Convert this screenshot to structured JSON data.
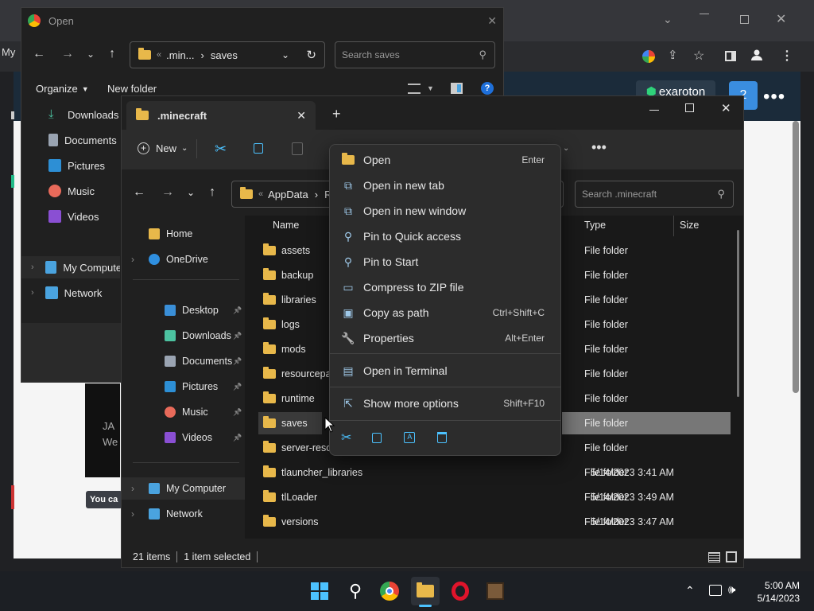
{
  "browser": {
    "left_label": "My",
    "profile_initial": "2",
    "exaroton": "exaroton",
    "web_text": "JA\nWe",
    "badge": "You ca"
  },
  "open_dialog": {
    "title": "Open",
    "path_prefix": "«",
    "path_parts": [
      ".min...",
      "saves"
    ],
    "search_placeholder": "Search saves",
    "organize": "Organize",
    "new_folder": "New folder",
    "sidebar": [
      {
        "label": "Downloads",
        "icon": "download-icon"
      },
      {
        "label": "Documents",
        "icon": "document-icon"
      },
      {
        "label": "Pictures",
        "icon": "picture-icon"
      },
      {
        "label": "Music",
        "icon": "music-icon"
      },
      {
        "label": "Videos",
        "icon": "video-icon"
      },
      {
        "label": "My Computer",
        "icon": "computer-icon"
      },
      {
        "label": "Network",
        "icon": "network-icon"
      }
    ]
  },
  "explorer": {
    "tab_title": ".minecraft",
    "new_label": "New",
    "path_prefix": "«",
    "path_parts": [
      "AppData",
      "Ro"
    ],
    "search_placeholder": "Search .minecraft",
    "columns": {
      "name": "Name",
      "type": "Type",
      "size": "Size"
    },
    "sidebar": [
      {
        "label": "Home",
        "icon": "home-icon"
      },
      {
        "label": "OneDrive",
        "icon": "onedrive-icon"
      },
      {
        "label": "Desktop",
        "icon": "desktop-icon"
      },
      {
        "label": "Downloads",
        "icon": "download-icon"
      },
      {
        "label": "Documents",
        "icon": "document-icon"
      },
      {
        "label": "Pictures",
        "icon": "picture-icon"
      },
      {
        "label": "Music",
        "icon": "music-icon"
      },
      {
        "label": "Videos",
        "icon": "video-icon"
      },
      {
        "label": "My Computer",
        "icon": "computer-icon"
      },
      {
        "label": "Network",
        "icon": "network-icon"
      }
    ],
    "files": [
      {
        "name": "assets",
        "date": "",
        "type": "File folder"
      },
      {
        "name": "backup",
        "date": "",
        "type": "File folder"
      },
      {
        "name": "libraries",
        "date": "",
        "type": "File folder"
      },
      {
        "name": "logs",
        "date": "",
        "type": "File folder"
      },
      {
        "name": "mods",
        "date": "",
        "type": "File folder"
      },
      {
        "name": "resourcepac",
        "date": "",
        "type": "File folder"
      },
      {
        "name": "runtime",
        "date": "",
        "type": "File folder"
      },
      {
        "name": "saves",
        "date": "",
        "type": "File folder"
      },
      {
        "name": "server-resou",
        "date": "",
        "type": "File folder"
      },
      {
        "name": "tlauncher_libraries",
        "date": "5/14/2023 3:41 AM",
        "type": "File folder"
      },
      {
        "name": "tlLoader",
        "date": "5/14/2023 3:49 AM",
        "type": "File folder"
      },
      {
        "name": "versions",
        "date": "5/14/2023 3:47 AM",
        "type": "File folder"
      }
    ],
    "selected_index": 7,
    "status": {
      "items": "21 items",
      "selected": "1 item selected"
    }
  },
  "context_menu": {
    "items": [
      {
        "label": "Open",
        "shortcut": "Enter",
        "icon": "folder-open-icon"
      },
      {
        "label": "Open in new tab",
        "shortcut": "",
        "icon": "new-tab-icon"
      },
      {
        "label": "Open in new window",
        "shortcut": "",
        "icon": "new-window-icon"
      },
      {
        "label": "Pin to Quick access",
        "shortcut": "",
        "icon": "pin-icon"
      },
      {
        "label": "Pin to Start",
        "shortcut": "",
        "icon": "pin-start-icon"
      },
      {
        "label": "Compress to ZIP file",
        "shortcut": "",
        "icon": "zip-icon"
      },
      {
        "label": "Copy as path",
        "shortcut": "Ctrl+Shift+C",
        "icon": "copy-path-icon"
      },
      {
        "label": "Properties",
        "shortcut": "Alt+Enter",
        "icon": "wrench-icon"
      },
      {
        "label": "Open in Terminal",
        "shortcut": "",
        "icon": "terminal-icon"
      },
      {
        "label": "Show more options",
        "shortcut": "Shift+F10",
        "icon": "more-options-icon"
      }
    ],
    "actions": [
      "cut-icon",
      "copy-icon",
      "rename-icon",
      "delete-icon"
    ]
  },
  "taskbar": {
    "time": "5:00 AM",
    "date": "5/14/2023"
  },
  "colors": {
    "accent": "#4cc2ff",
    "folder": "#e8b84a",
    "selected_row": "#777777"
  }
}
